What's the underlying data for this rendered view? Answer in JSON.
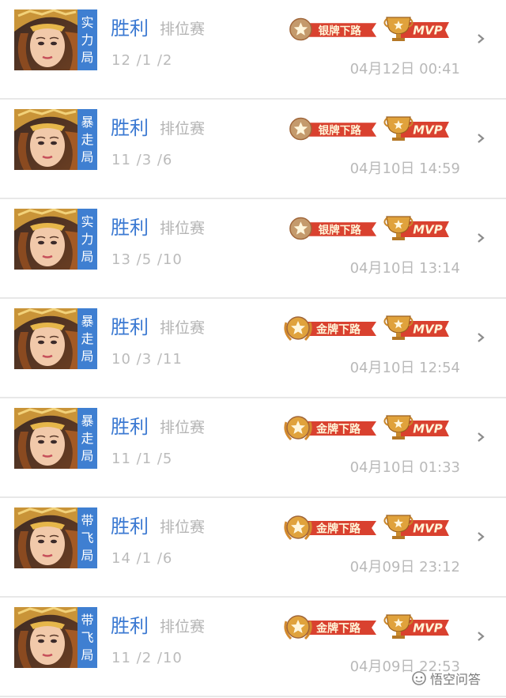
{
  "matches": [
    {
      "mode_chars": [
        "实",
        "力",
        "局"
      ],
      "result": "胜利",
      "match_type": "排位赛",
      "kda": "12 /1 /2",
      "rank_badge": "银牌下路",
      "rank_tier": "silver",
      "mvp": "MVP",
      "date": "04月12日 00:41"
    },
    {
      "mode_chars": [
        "暴",
        "走",
        "局"
      ],
      "result": "胜利",
      "match_type": "排位赛",
      "kda": "11 /3 /6",
      "rank_badge": "银牌下路",
      "rank_tier": "silver",
      "mvp": "MVP",
      "date": "04月10日 14:59"
    },
    {
      "mode_chars": [
        "实",
        "力",
        "局"
      ],
      "result": "胜利",
      "match_type": "排位赛",
      "kda": "13 /5 /10",
      "rank_badge": "银牌下路",
      "rank_tier": "silver",
      "mvp": "MVP",
      "date": "04月10日 13:14"
    },
    {
      "mode_chars": [
        "暴",
        "走",
        "局"
      ],
      "result": "胜利",
      "match_type": "排位赛",
      "kda": "10 /3 /11",
      "rank_badge": "金牌下路",
      "rank_tier": "gold",
      "mvp": "MVP",
      "date": "04月10日 12:54"
    },
    {
      "mode_chars": [
        "暴",
        "走",
        "局"
      ],
      "result": "胜利",
      "match_type": "排位赛",
      "kda": "11 /1 /5",
      "rank_badge": "金牌下路",
      "rank_tier": "gold",
      "mvp": "MVP",
      "date": "04月10日 01:33"
    },
    {
      "mode_chars": [
        "带",
        "飞",
        "局"
      ],
      "result": "胜利",
      "match_type": "排位赛",
      "kda": "14 /1 /6",
      "rank_badge": "金牌下路",
      "rank_tier": "gold",
      "mvp": "MVP",
      "date": "04月09日 23:12"
    },
    {
      "mode_chars": [
        "带",
        "飞",
        "局"
      ],
      "result": "胜利",
      "match_type": "排位赛",
      "kda": "11 /2 /10",
      "rank_badge": "金牌下路",
      "rank_tier": "gold",
      "mvp": "MVP",
      "date": "04月09日 22:53"
    }
  ],
  "colors": {
    "result_blue": "#3b79d2",
    "mode_tag_blue": "#3f7fd1",
    "ribbon_red": "#d9412f",
    "silver_medal": "#c49a6c",
    "gold_medal": "#e0a23c"
  },
  "watermark": {
    "text": "悟空问答",
    "icon": "wukong-logo"
  }
}
